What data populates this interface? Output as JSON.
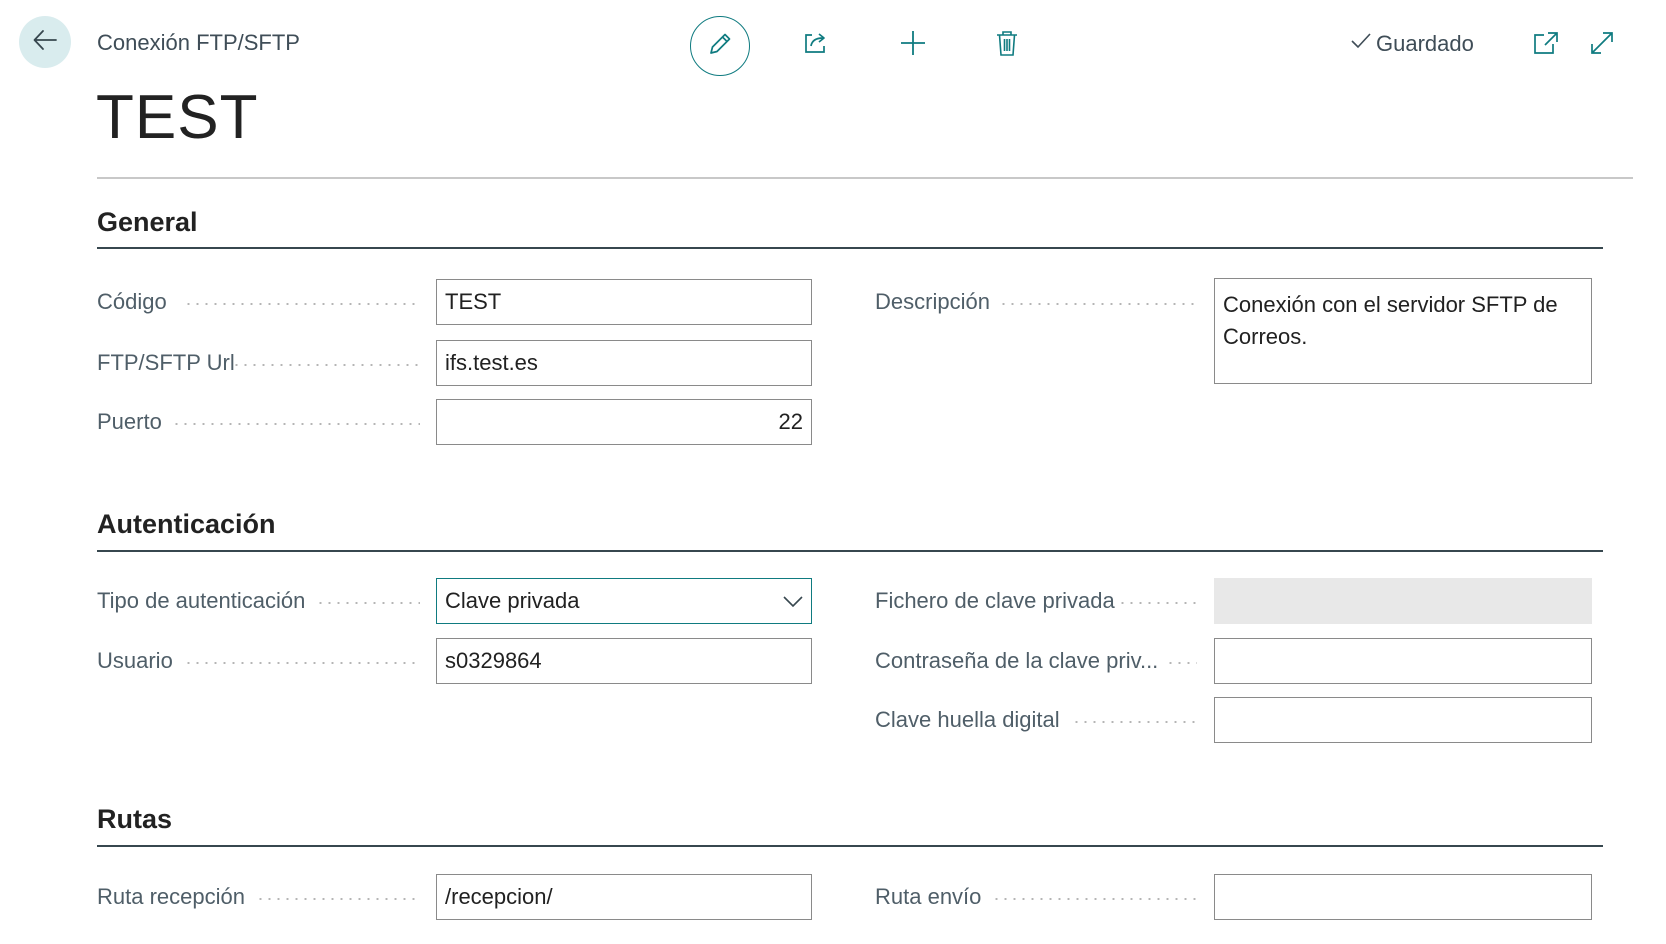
{
  "header": {
    "breadcrumb": "Conexión FTP/SFTP",
    "title": "TEST",
    "saved_label": "Guardado"
  },
  "icons": {
    "back": "arrow-left-icon",
    "edit": "pencil-icon",
    "share": "share-icon",
    "new": "plus-icon",
    "delete": "trash-icon",
    "saved": "checkmark-icon",
    "open_new_window": "open-new-window-icon",
    "expand": "expand-icon",
    "dropdown": "chevron-down-icon"
  },
  "colors": {
    "accent": "#0f7b80",
    "back_bg": "#d9ecee",
    "disabled_field": "#e8e8e8"
  },
  "sections": {
    "general": {
      "title": "General",
      "codigo_label": "Código",
      "codigo_value": "TEST",
      "url_label": "FTP/SFTP Url",
      "url_value": "ifs.test.es",
      "puerto_label": "Puerto",
      "puerto_value": "22",
      "descripcion_label": "Descripción",
      "descripcion_value": "Conexión con el servidor SFTP de Correos."
    },
    "auth": {
      "title": "Autenticación",
      "tipo_label": "Tipo de autenticación",
      "tipo_value": "Clave privada",
      "usuario_label": "Usuario",
      "usuario_value": "s0329864",
      "fichero_label": "Fichero de clave privada",
      "fichero_value": "",
      "contrasena_label": "Contraseña de la clave priv...",
      "contrasena_value": "",
      "huella_label": "Clave huella digital",
      "huella_value": ""
    },
    "rutas": {
      "title": "Rutas",
      "recepcion_label": "Ruta recepción",
      "recepcion_value": "/recepcion/",
      "envio_label": "Ruta envío",
      "envio_value": ""
    }
  }
}
